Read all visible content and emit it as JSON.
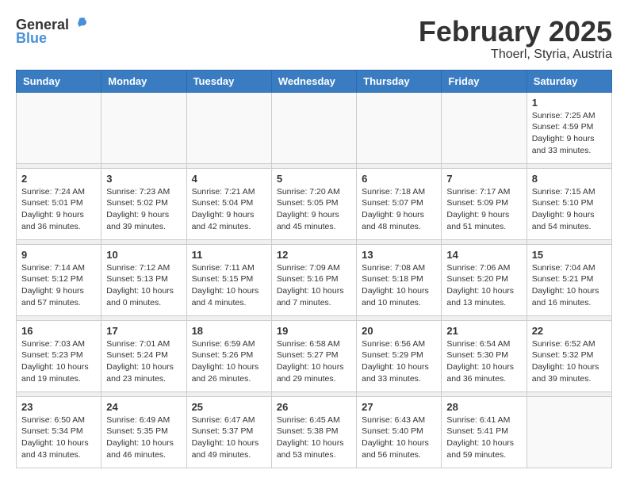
{
  "header": {
    "logo_general": "General",
    "logo_blue": "Blue",
    "month_year": "February 2025",
    "location": "Thoerl, Styria, Austria"
  },
  "weekdays": [
    "Sunday",
    "Monday",
    "Tuesday",
    "Wednesday",
    "Thursday",
    "Friday",
    "Saturday"
  ],
  "weeks": [
    [
      {
        "day": "",
        "info": ""
      },
      {
        "day": "",
        "info": ""
      },
      {
        "day": "",
        "info": ""
      },
      {
        "day": "",
        "info": ""
      },
      {
        "day": "",
        "info": ""
      },
      {
        "day": "",
        "info": ""
      },
      {
        "day": "1",
        "info": "Sunrise: 7:25 AM\nSunset: 4:59 PM\nDaylight: 9 hours and 33 minutes."
      }
    ],
    [
      {
        "day": "2",
        "info": "Sunrise: 7:24 AM\nSunset: 5:01 PM\nDaylight: 9 hours and 36 minutes."
      },
      {
        "day": "3",
        "info": "Sunrise: 7:23 AM\nSunset: 5:02 PM\nDaylight: 9 hours and 39 minutes."
      },
      {
        "day": "4",
        "info": "Sunrise: 7:21 AM\nSunset: 5:04 PM\nDaylight: 9 hours and 42 minutes."
      },
      {
        "day": "5",
        "info": "Sunrise: 7:20 AM\nSunset: 5:05 PM\nDaylight: 9 hours and 45 minutes."
      },
      {
        "day": "6",
        "info": "Sunrise: 7:18 AM\nSunset: 5:07 PM\nDaylight: 9 hours and 48 minutes."
      },
      {
        "day": "7",
        "info": "Sunrise: 7:17 AM\nSunset: 5:09 PM\nDaylight: 9 hours and 51 minutes."
      },
      {
        "day": "8",
        "info": "Sunrise: 7:15 AM\nSunset: 5:10 PM\nDaylight: 9 hours and 54 minutes."
      }
    ],
    [
      {
        "day": "9",
        "info": "Sunrise: 7:14 AM\nSunset: 5:12 PM\nDaylight: 9 hours and 57 minutes."
      },
      {
        "day": "10",
        "info": "Sunrise: 7:12 AM\nSunset: 5:13 PM\nDaylight: 10 hours and 0 minutes."
      },
      {
        "day": "11",
        "info": "Sunrise: 7:11 AM\nSunset: 5:15 PM\nDaylight: 10 hours and 4 minutes."
      },
      {
        "day": "12",
        "info": "Sunrise: 7:09 AM\nSunset: 5:16 PM\nDaylight: 10 hours and 7 minutes."
      },
      {
        "day": "13",
        "info": "Sunrise: 7:08 AM\nSunset: 5:18 PM\nDaylight: 10 hours and 10 minutes."
      },
      {
        "day": "14",
        "info": "Sunrise: 7:06 AM\nSunset: 5:20 PM\nDaylight: 10 hours and 13 minutes."
      },
      {
        "day": "15",
        "info": "Sunrise: 7:04 AM\nSunset: 5:21 PM\nDaylight: 10 hours and 16 minutes."
      }
    ],
    [
      {
        "day": "16",
        "info": "Sunrise: 7:03 AM\nSunset: 5:23 PM\nDaylight: 10 hours and 19 minutes."
      },
      {
        "day": "17",
        "info": "Sunrise: 7:01 AM\nSunset: 5:24 PM\nDaylight: 10 hours and 23 minutes."
      },
      {
        "day": "18",
        "info": "Sunrise: 6:59 AM\nSunset: 5:26 PM\nDaylight: 10 hours and 26 minutes."
      },
      {
        "day": "19",
        "info": "Sunrise: 6:58 AM\nSunset: 5:27 PM\nDaylight: 10 hours and 29 minutes."
      },
      {
        "day": "20",
        "info": "Sunrise: 6:56 AM\nSunset: 5:29 PM\nDaylight: 10 hours and 33 minutes."
      },
      {
        "day": "21",
        "info": "Sunrise: 6:54 AM\nSunset: 5:30 PM\nDaylight: 10 hours and 36 minutes."
      },
      {
        "day": "22",
        "info": "Sunrise: 6:52 AM\nSunset: 5:32 PM\nDaylight: 10 hours and 39 minutes."
      }
    ],
    [
      {
        "day": "23",
        "info": "Sunrise: 6:50 AM\nSunset: 5:34 PM\nDaylight: 10 hours and 43 minutes."
      },
      {
        "day": "24",
        "info": "Sunrise: 6:49 AM\nSunset: 5:35 PM\nDaylight: 10 hours and 46 minutes."
      },
      {
        "day": "25",
        "info": "Sunrise: 6:47 AM\nSunset: 5:37 PM\nDaylight: 10 hours and 49 minutes."
      },
      {
        "day": "26",
        "info": "Sunrise: 6:45 AM\nSunset: 5:38 PM\nDaylight: 10 hours and 53 minutes."
      },
      {
        "day": "27",
        "info": "Sunrise: 6:43 AM\nSunset: 5:40 PM\nDaylight: 10 hours and 56 minutes."
      },
      {
        "day": "28",
        "info": "Sunrise: 6:41 AM\nSunset: 5:41 PM\nDaylight: 10 hours and 59 minutes."
      },
      {
        "day": "",
        "info": ""
      }
    ]
  ]
}
